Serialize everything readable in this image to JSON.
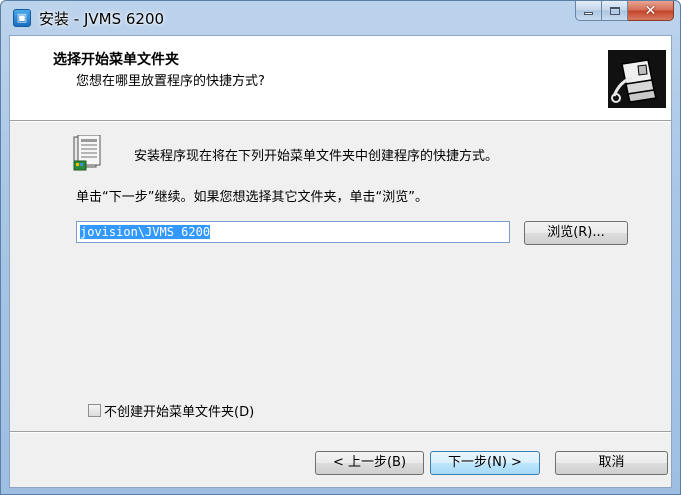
{
  "window": {
    "title": "安装 - JVMS 6200"
  },
  "header": {
    "title": "选择开始菜单文件夹",
    "subtitle": "您想在哪里放置程序的快捷方式?"
  },
  "body": {
    "intro": "安装程序现在将在下列开始菜单文件夹中创建程序的快捷方式。",
    "instruction": "单击“下一步”继续。如果您想选择其它文件夹，单击“浏览”。",
    "folder_path": "jovision\\JVMS 6200",
    "browse_label": "浏览(R)...",
    "no_folder_checkbox": {
      "label": "不创建开始菜单文件夹(D)",
      "checked": false
    }
  },
  "footer": {
    "back_label": "< 上一步(B)",
    "next_label": "下一步(N) >",
    "cancel_label": "取消"
  },
  "icons": {
    "app": "installer-app-icon",
    "header": "computer-install-icon",
    "folder": "start-menu-folder-icon"
  },
  "colors": {
    "frame": "#a9c6e6",
    "close_button": "#c2432a",
    "selection": "#3399ff",
    "default_button_border": "#3c7fb1"
  }
}
